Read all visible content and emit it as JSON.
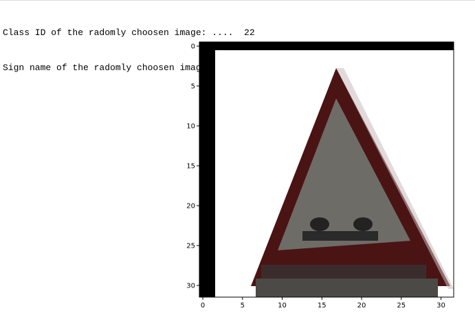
{
  "output": {
    "class_line": "Class ID of the radomly choosen image: ....  22",
    "sign_line": "Sign name of the radomly choosen image: .... Bumpy road"
  },
  "plot": {
    "x_ticks": [
      "0",
      "5",
      "10",
      "15",
      "20",
      "25",
      "30"
    ],
    "y_ticks": [
      "0",
      "5",
      "10",
      "15",
      "20",
      "25",
      "30"
    ]
  },
  "colors": {
    "border": "#000000",
    "sign_rim": "#4a1414",
    "sign_inner": "#6e6c66",
    "sign_symbol": "#222222",
    "background": "#ffffff"
  }
}
